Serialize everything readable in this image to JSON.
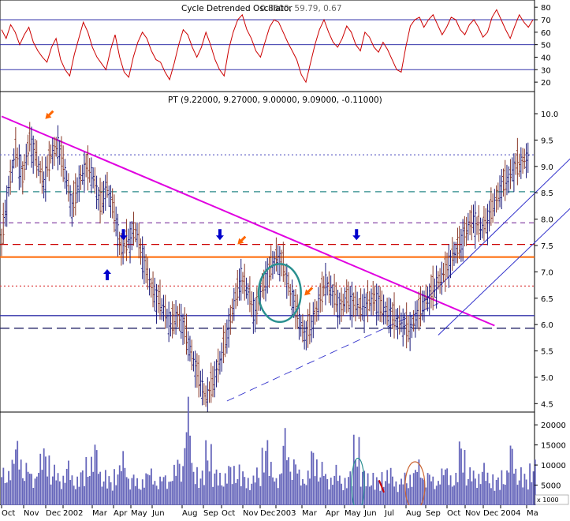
{
  "chart_data": [
    {
      "type": "line",
      "panel": "indicator",
      "title": "Cycle Detrended Oscillator",
      "title_overlay": "0.8600, 59.79, 0.67",
      "y_ticks": [
        20,
        30,
        40,
        50,
        60,
        70,
        80
      ],
      "ylim": [
        15,
        82
      ],
      "reference_lines": [
        70,
        50,
        30
      ],
      "series": [
        {
          "color": "#cc0000",
          "values": [
            62,
            55,
            66,
            60,
            50,
            58,
            64,
            52,
            45,
            40,
            36,
            48,
            55,
            38,
            30,
            25,
            42,
            55,
            68,
            60,
            48,
            40,
            35,
            30,
            46,
            58,
            40,
            28,
            24,
            40,
            52,
            60,
            55,
            45,
            38,
            36,
            28,
            22,
            35,
            50,
            62,
            58,
            48,
            40,
            48,
            60,
            50,
            38,
            30,
            25,
            46,
            60,
            70,
            74,
            62,
            55,
            45,
            40,
            52,
            64,
            70,
            68,
            60,
            52,
            45,
            38,
            26,
            20,
            35,
            50,
            62,
            70,
            60,
            52,
            48,
            55,
            65,
            60,
            50,
            45,
            60,
            56,
            48,
            44,
            52,
            46,
            38,
            30,
            28,
            48,
            65,
            70,
            72,
            64,
            70,
            74,
            66,
            58,
            64,
            72,
            70,
            62,
            58,
            66,
            70,
            64,
            56,
            60,
            72,
            78,
            70,
            62,
            55,
            65,
            74,
            68,
            64,
            70
          ]
        }
      ]
    },
    {
      "type": "candlestick",
      "panel": "price",
      "title": "PT",
      "title_values": "(9.22000, 9.27000, 9.00000, 9.09000, -0.11000)",
      "y_ticks": [
        "4.5",
        "5.0",
        "5.5",
        "6.0",
        "6.5",
        "7.0",
        "7.5",
        "8.0",
        "8.5",
        "9.0",
        "9.5",
        "10.0"
      ],
      "ylim": [
        4.4,
        10.3
      ],
      "x_ticks": [
        "Oct",
        "Nov",
        "Dec",
        "2002",
        "Mar",
        "Apr",
        "May",
        "Jun",
        "Aug",
        "Sep",
        "Oct",
        "Nov",
        "Dec",
        "2003",
        "Mar",
        "Apr",
        "May",
        "Jun",
        "Jul",
        "Aug",
        "Sep",
        "Oct",
        "Nov",
        "Dec",
        "2004",
        "Ma"
      ],
      "close": [
        7.6,
        8.6,
        9.3,
        8.8,
        9.5,
        9.1,
        8.7,
        9.2,
        9.4,
        8.9,
        8.2,
        8.7,
        9.0,
        8.8,
        8.3,
        8.6,
        8.1,
        7.4,
        7.6,
        7.8,
        7.3,
        6.8,
        6.5,
        6.3,
        6.0,
        6.2,
        5.9,
        5.4,
        5.0,
        4.6,
        4.9,
        5.3,
        5.8,
        6.4,
        6.9,
        6.6,
        6.2,
        6.7,
        7.0,
        7.3,
        7.1,
        6.6,
        6.2,
        5.8,
        6.0,
        6.4,
        6.8,
        6.6,
        6.3,
        6.5,
        6.4,
        6.3,
        6.4,
        6.5,
        6.3,
        6.2,
        6.1,
        6.0,
        5.9,
        6.2,
        6.4,
        6.6,
        6.8,
        7.0,
        7.3,
        7.5,
        7.8,
        8.0,
        7.8,
        8.0,
        8.3,
        8.6,
        8.8,
        9.0,
        9.1,
        9.2
      ],
      "x_domain": [
        0,
        75
      ],
      "y_domain": [
        4.4,
        10.3
      ],
      "resistance_trendline": {
        "from": [
          0,
          9.95
        ],
        "to": [
          70,
          5.98
        ],
        "color": "#e000e0"
      },
      "support_trendline": {
        "from": [
          32,
          4.55
        ],
        "to": [
          62,
          6.4
        ],
        "color": "#3333cc"
      },
      "channel_upper": {
        "from": [
          60,
          6.45
        ],
        "to": [
          85,
          9.7
        ],
        "color": "#3333cc"
      },
      "channel_lower": {
        "from": [
          62,
          5.8
        ],
        "to": [
          85,
          8.75
        ],
        "color": "#3333cc"
      },
      "horizontal_levels": [
        {
          "price": 9.22,
          "color": "#6a6ac8",
          "dash": "2,3"
        },
        {
          "price": 8.52,
          "color": "#2a8a8a",
          "dash": "8,6"
        },
        {
          "price": 7.93,
          "color": "#8a4aa8",
          "dash": "6,5"
        },
        {
          "price": 7.52,
          "color": "#cc0000",
          "dash": "10,6"
        },
        {
          "price": 7.28,
          "color": "#ff6600",
          "dash": ""
        },
        {
          "price": 6.73,
          "color": "#dd4444",
          "dash": "2,3"
        },
        {
          "price": 6.17,
          "color": "#3333aa",
          "dash": ""
        },
        {
          "price": 5.93,
          "color": "#222266",
          "dash": "12,6"
        }
      ],
      "annotations": [
        {
          "shape": "ellipse",
          "x": 39.5,
          "y": 6.6,
          "rx": 3.0,
          "ry": 0.55,
          "color": "#2a9090"
        },
        {
          "shape": "arrow-down",
          "x": 17.3,
          "y": 7.6,
          "color": "#0000cc"
        },
        {
          "shape": "arrow-up",
          "x": 15.0,
          "y": 7.05,
          "color": "#0000cc"
        },
        {
          "shape": "arrow-down",
          "x": 31.0,
          "y": 7.6,
          "color": "#0000cc"
        },
        {
          "shape": "arrow-down",
          "x": 50.4,
          "y": 7.6,
          "color": "#0000cc"
        },
        {
          "shape": "arrow-diag",
          "x": 6.2,
          "y": 9.9,
          "color": "#ff6600"
        },
        {
          "shape": "arrow-diag",
          "x": 33.5,
          "y": 7.52,
          "color": "#ff6600"
        },
        {
          "shape": "arrow-diag",
          "x": 43.0,
          "y": 6.55,
          "color": "#ff6600"
        }
      ]
    },
    {
      "type": "bar",
      "panel": "volume",
      "y_ticks": [
        5000,
        10000,
        15000,
        20000
      ],
      "ylim": [
        0,
        22000
      ],
      "unit_label": "x 1000",
      "values": [
        7000,
        9000,
        12500,
        8000,
        6500,
        9500,
        11000,
        7500,
        6000,
        8500,
        5500,
        7000,
        9000,
        12000,
        6500,
        5500,
        7500,
        10000,
        6000,
        5000,
        6500,
        7000,
        5500,
        6000,
        7500,
        9000,
        20000,
        8000,
        6500,
        12000,
        7000,
        6000,
        8000,
        7500,
        6500,
        5500,
        7000,
        12500,
        8000,
        6500,
        14500,
        9000,
        7000,
        6500,
        11000,
        8000,
        6000,
        7500,
        5500,
        6500,
        13000,
        7000,
        6000,
        5500,
        6500,
        7000,
        5000,
        6000,
        7000,
        8500,
        6500,
        5500,
        7000,
        7500,
        6000,
        12500,
        7000,
        6500,
        8000,
        6000,
        5500,
        6500,
        12000,
        7000,
        6000,
        8500
      ],
      "ellipses": [
        {
          "x": 50.6,
          "y": 6500,
          "rx": 0.9,
          "ry": 6500,
          "color": "#2a9090"
        },
        {
          "x": 58.7,
          "y": 6000,
          "rx": 1.4,
          "ry": 6000,
          "color": "#cc6633"
        }
      ]
    }
  ]
}
